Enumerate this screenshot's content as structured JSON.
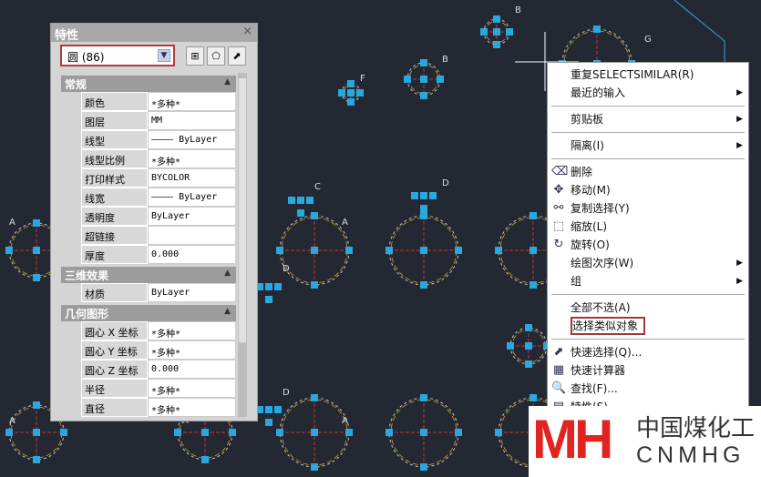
{
  "drawing": {
    "labels": [
      "B",
      "B",
      "G",
      "F",
      "C",
      "D",
      "A",
      "A",
      "A",
      "D",
      "D",
      "A",
      "A",
      "A"
    ],
    "accent": "#29a8e0"
  },
  "panel": {
    "title": "特性",
    "close": "×",
    "selector": "圆 (86)",
    "sections": [
      {
        "title": "常规",
        "rows": [
          [
            "颜色",
            "*多种*"
          ],
          [
            "图层",
            "MM"
          ],
          [
            "线型",
            "———— ByLayer"
          ],
          [
            "线型比例",
            "*多种*"
          ],
          [
            "打印样式",
            "BYCOLOR"
          ],
          [
            "线宽",
            "———— ByLayer"
          ],
          [
            "透明度",
            "ByLayer"
          ],
          [
            "超链接",
            ""
          ],
          [
            "厚度",
            "0.000"
          ]
        ]
      },
      {
        "title": "三维效果",
        "rows": [
          [
            "材质",
            "ByLayer"
          ]
        ]
      },
      {
        "title": "几何图形",
        "rows": [
          [
            "圆心 X 坐标",
            "*多种*"
          ],
          [
            "圆心 Y 坐标",
            "*多种*"
          ],
          [
            "圆心 Z 坐标",
            "0.000"
          ],
          [
            "半径",
            "*多种*"
          ],
          [
            "直径",
            "*多种*"
          ]
        ]
      }
    ]
  },
  "menu": {
    "items": [
      {
        "label": "重复SELECTSIMILAR(R)"
      },
      {
        "label": "最近的输入",
        "sub": true
      },
      {
        "sep": true
      },
      {
        "label": "剪贴板",
        "sub": true
      },
      {
        "sep": true
      },
      {
        "label": "隔离(I)",
        "sub": true
      },
      {
        "sep": true
      },
      {
        "label": "删除",
        "icon": "⌫"
      },
      {
        "label": "移动(M)",
        "icon": "✥"
      },
      {
        "label": "复制选择(Y)",
        "icon": "⚯"
      },
      {
        "label": "缩放(L)",
        "icon": "⬚"
      },
      {
        "label": "旋转(O)",
        "icon": "↻"
      },
      {
        "label": "绘图次序(W)",
        "sub": true
      },
      {
        "label": "组",
        "sub": true
      },
      {
        "sep": true
      },
      {
        "label": "全部不选(A)"
      },
      {
        "label": "选择类似对象",
        "highlight": true
      },
      {
        "sep": true
      },
      {
        "label": "快速选择(Q)...",
        "icon": "⬈"
      },
      {
        "label": "快速计算器",
        "icon": "▦"
      },
      {
        "label": "查找(F)...",
        "icon": "🔍"
      },
      {
        "label": "特性(S)",
        "icon": "▤"
      }
    ]
  },
  "logo": {
    "cn": "中国煤化工",
    "en": "CNMHG",
    "mark": "MH"
  }
}
